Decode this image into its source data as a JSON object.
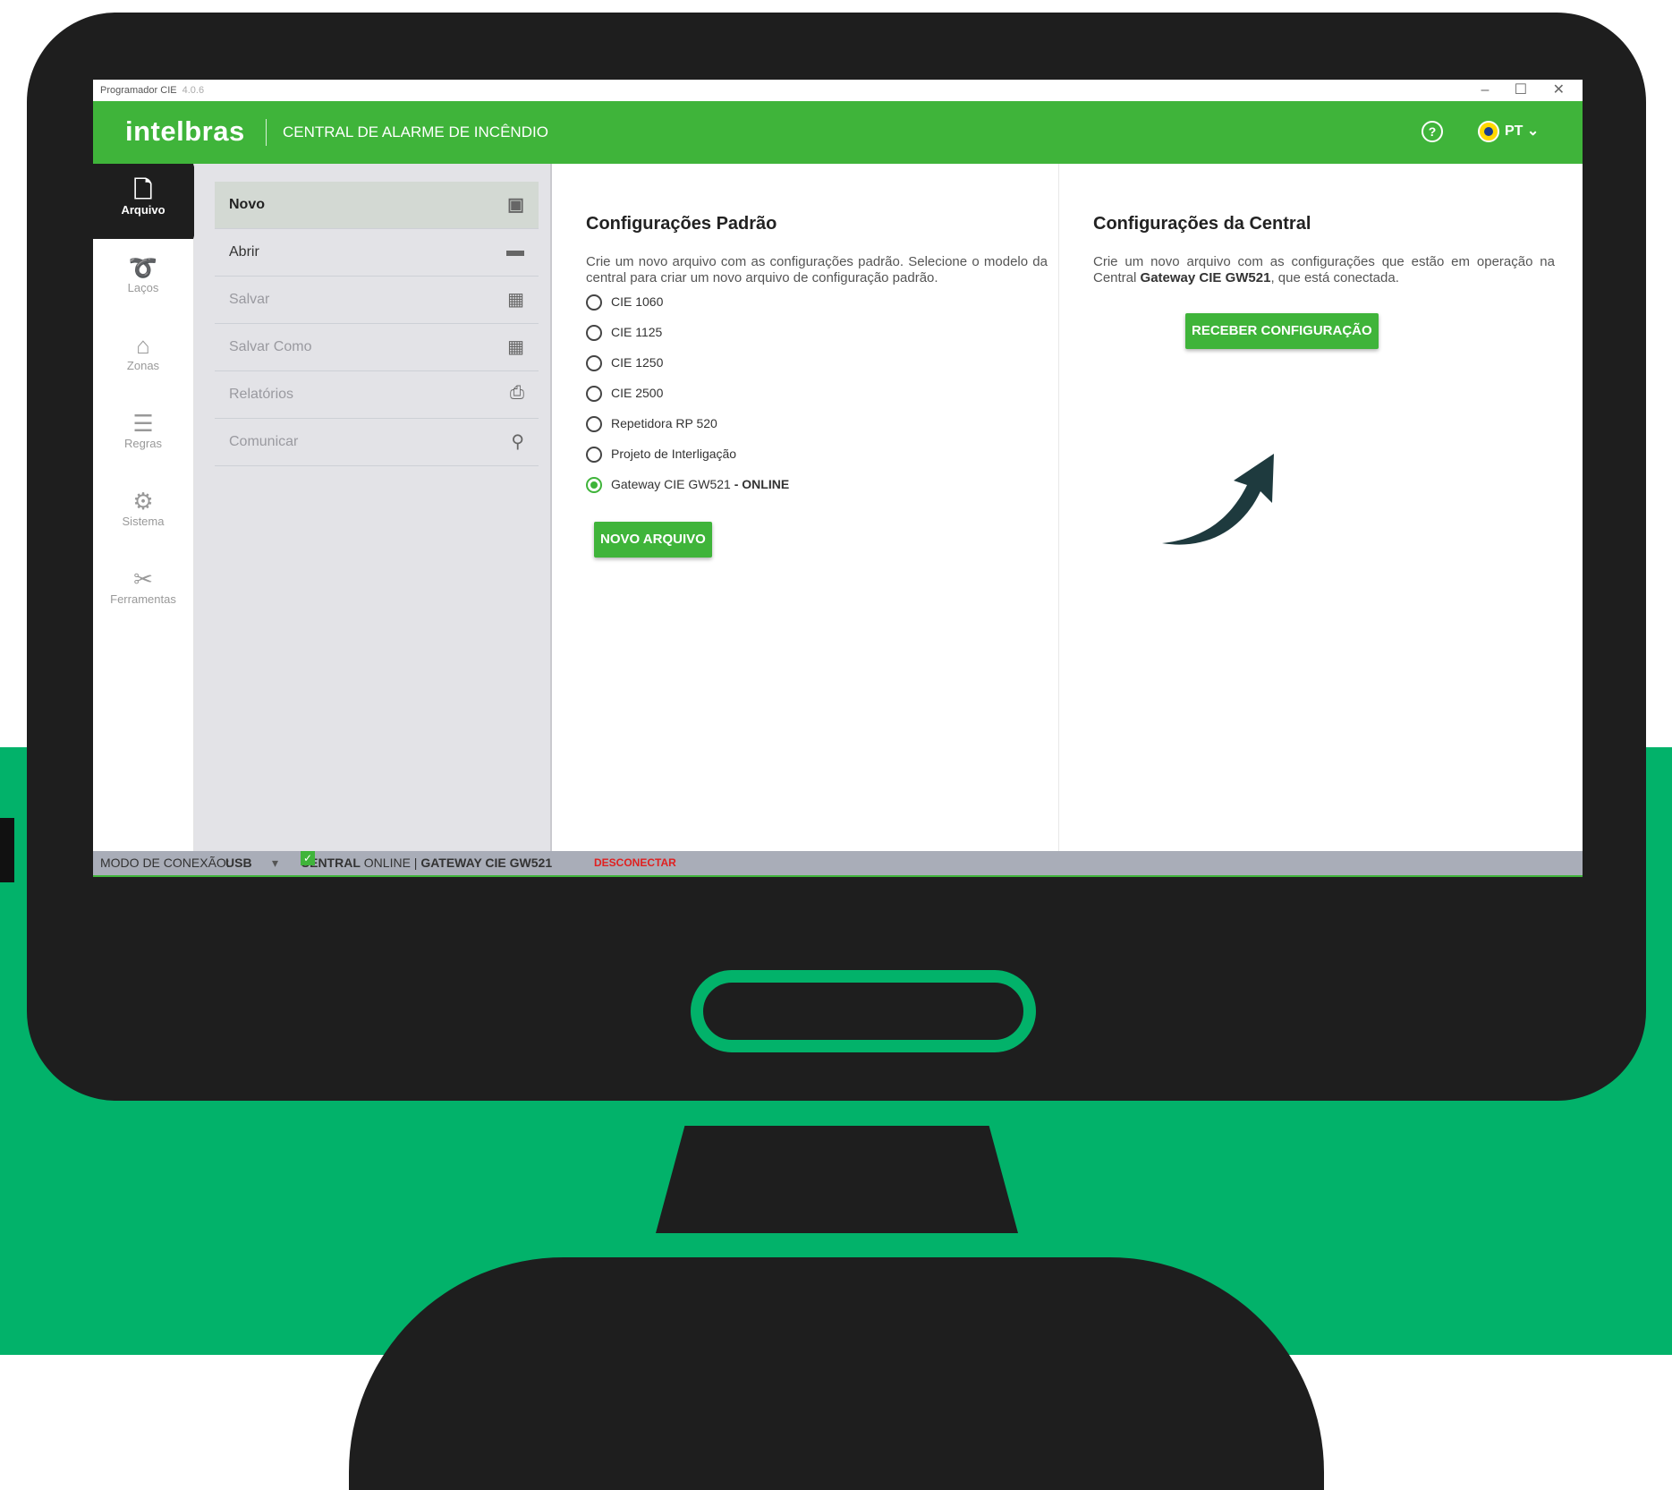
{
  "window": {
    "title": "Programador CIE",
    "version": "4.0.6",
    "controls": "–  ☐  ✕"
  },
  "header": {
    "logo": "intelbras",
    "title": "CENTRAL DE ALARME DE INCÊNDIO",
    "help": "?",
    "lang": "PT",
    "lang_chevron": "⌄"
  },
  "nav": [
    {
      "label": "Arquivo",
      "icon": "file-icon",
      "glyph": "🗋"
    },
    {
      "label": "Laços",
      "icon": "loop-icon",
      "glyph": "➰"
    },
    {
      "label": "Zonas",
      "icon": "home-icon",
      "glyph": "⌂"
    },
    {
      "label": "Regras",
      "icon": "rules-icon",
      "glyph": "☰"
    },
    {
      "label": "Sistema",
      "icon": "gear-icon",
      "glyph": "⚙"
    },
    {
      "label": "Ferramentas",
      "icon": "tools-icon",
      "glyph": "✂"
    }
  ],
  "menu": [
    {
      "label": "Novo",
      "icon": "new-folder-icon",
      "glyph": "▣"
    },
    {
      "label": "Abrir",
      "icon": "folder-icon",
      "glyph": "▬"
    },
    {
      "label": "Salvar",
      "icon": "save-icon",
      "glyph": "▦"
    },
    {
      "label": "Salvar Como",
      "icon": "save-as-icon",
      "glyph": "▦"
    },
    {
      "label": "Relatórios",
      "icon": "print-icon",
      "glyph": "⎙"
    },
    {
      "label": "Comunicar",
      "icon": "usb-icon",
      "glyph": "⚲"
    }
  ],
  "default_config": {
    "title": "Configurações Padrão",
    "description": "Crie um novo arquivo com as configurações padrão. Selecione o modelo da central para criar um novo arquivo de configuração padrão.",
    "options": [
      "CIE 1060",
      "CIE 1125",
      "CIE 1250",
      "CIE 2500",
      "Repetidora RP 520",
      "Projeto de Interligação",
      "Gateway CIE GW521"
    ],
    "selected_suffix": " - ONLINE",
    "selected_index": 6,
    "button": "NOVO ARQUIVO"
  },
  "central_config": {
    "title": "Configurações da Central",
    "desc_pre": "Crie um novo arquivo com as configurações que estão em operação na Central ",
    "desc_bold": "Gateway CIE GW521",
    "desc_post": ", que está conectada.",
    "button": "RECEBER CONFIGURAÇÃO"
  },
  "status": {
    "mode_label": "MODO DE CONEXÃO:",
    "mode_value": "USB",
    "mode_caret": "▾",
    "central": "CENTRAL",
    "online": "ONLINE |",
    "gateway": "GATEWAY CIE GW521",
    "disconnect": "DESCONECTAR"
  },
  "colors": {
    "brand_green": "#3fb43a",
    "background_green": "#02b26a",
    "monitor": "#1e1e1e",
    "arrow": "#1e3a3e"
  }
}
